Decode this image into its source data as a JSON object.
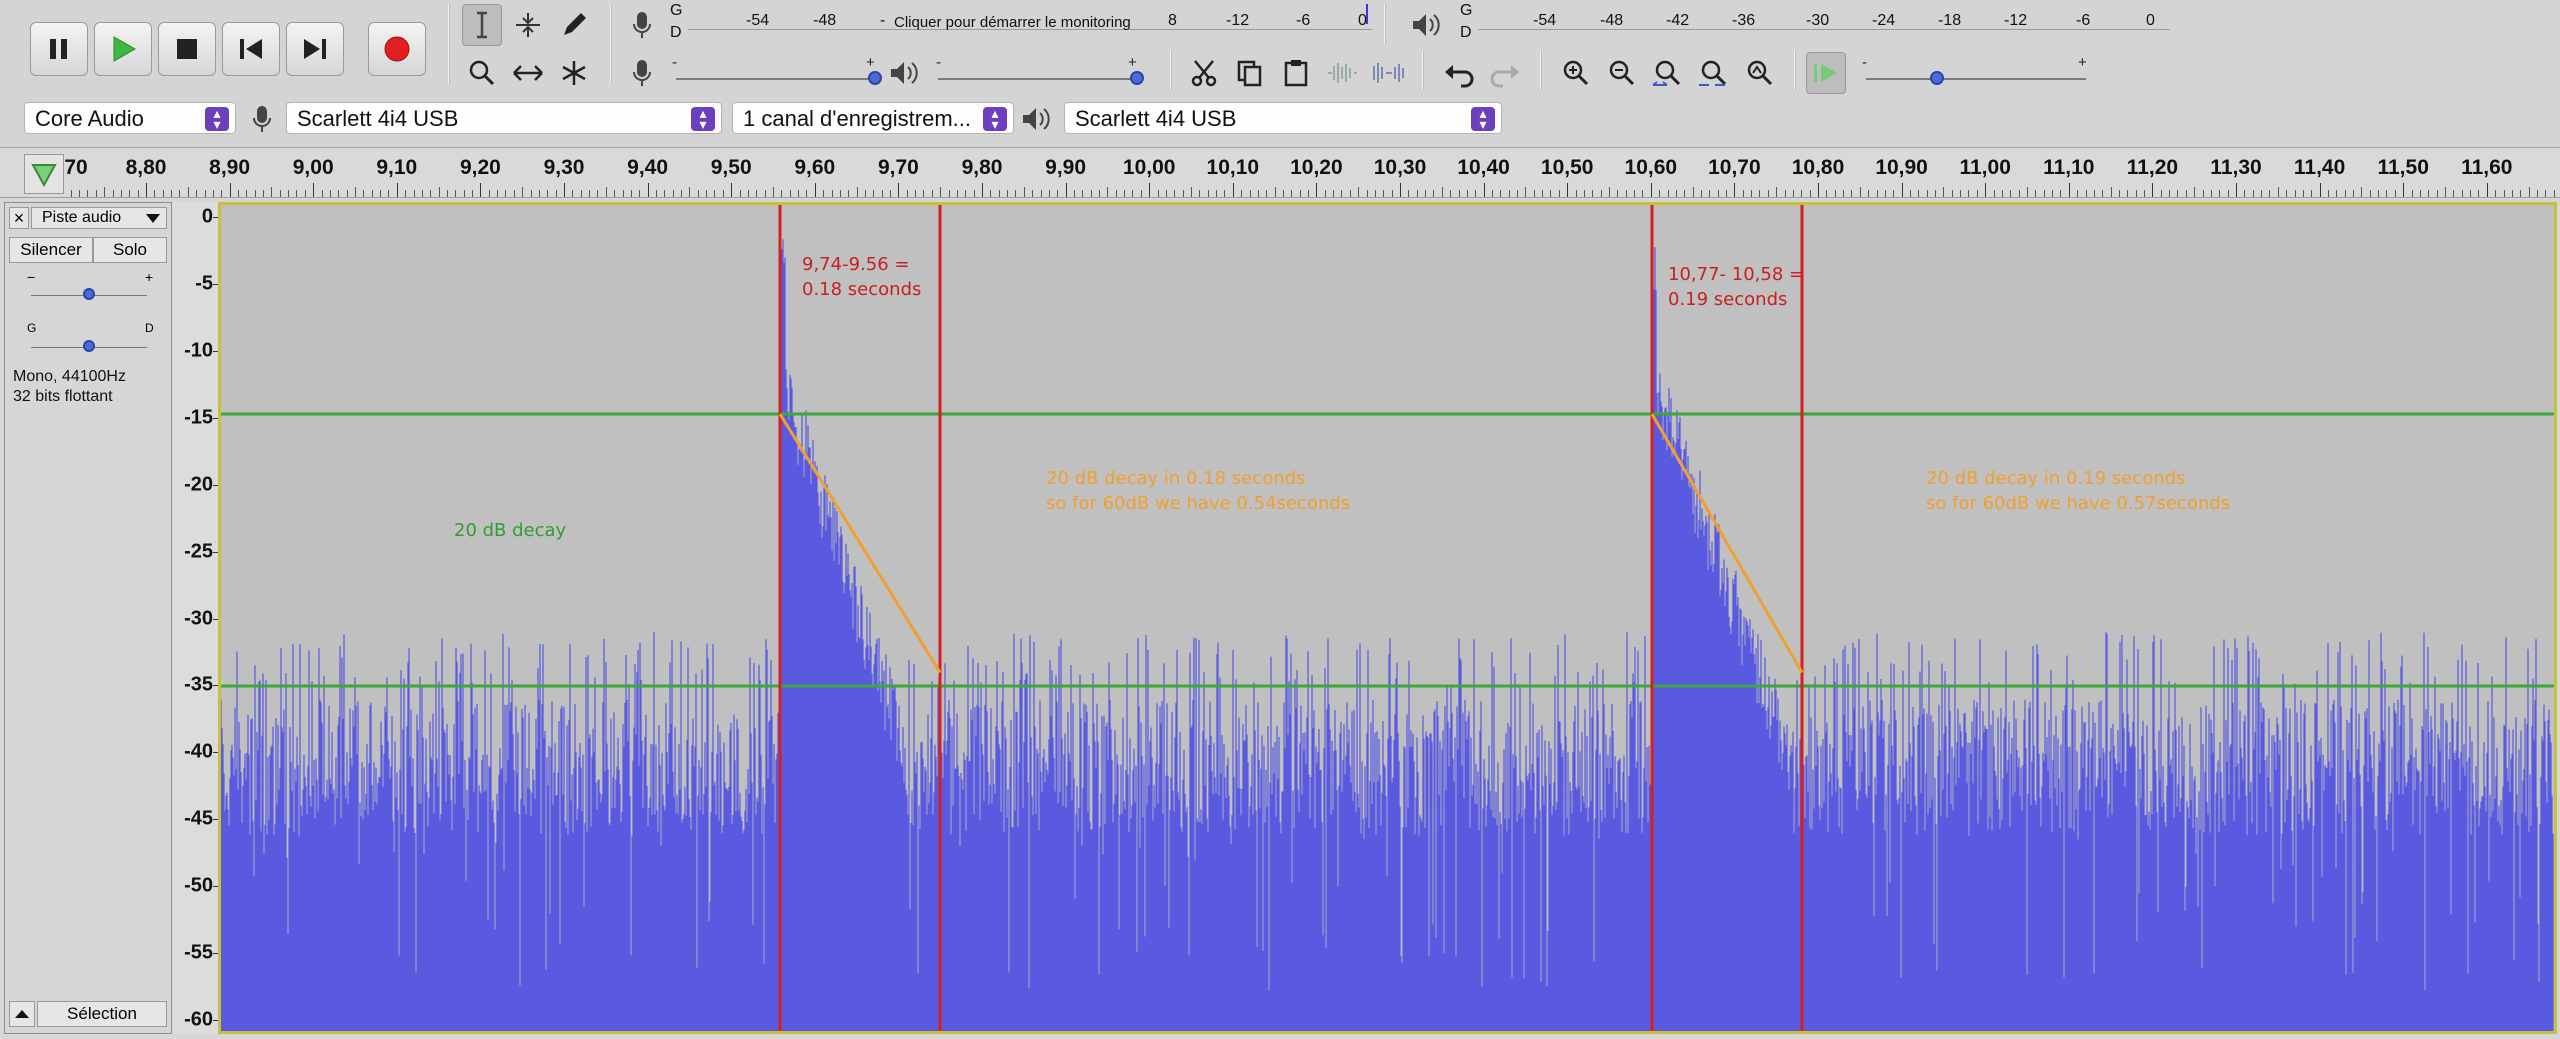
{
  "toolbar": {
    "transport": [
      {
        "name": "pause-button",
        "icon": "pause-icon"
      },
      {
        "name": "play-button",
        "icon": "play-icon"
      },
      {
        "name": "stop-button",
        "icon": "stop-icon"
      },
      {
        "name": "skip-start-button",
        "icon": "skip-to-start-icon"
      },
      {
        "name": "skip-end-button",
        "icon": "skip-to-end-icon"
      },
      {
        "name": "record-button",
        "icon": "record-icon"
      }
    ],
    "record_meter": {
      "channel_top": "G",
      "channel_bottom": "D",
      "ticks": [
        "-54",
        "-48",
        "-",
        "-12",
        "-6",
        "0"
      ],
      "monitor_prompt": "Cliquer pour démarrer le monitoring",
      "monitor_tick": "8"
    },
    "play_meter": {
      "channel_top": "G",
      "channel_bottom": "D",
      "ticks": [
        "-54",
        "-48",
        "-42",
        "-36",
        "-30",
        "-24",
        "-18",
        "-12",
        "-6",
        "0"
      ]
    },
    "rec_volume": {
      "minus": "-",
      "plus": "+"
    },
    "play_volume": {
      "minus": "-",
      "plus": "+"
    },
    "play_speed": {
      "minus": "-",
      "plus": "+"
    }
  },
  "devices": {
    "host": "Core Audio",
    "recording_device": "Scarlett 4i4 USB",
    "channels": "1 canal d'enregistrem...",
    "playback_device": "Scarlett 4i4 USB"
  },
  "timeline": {
    "first_label": "70",
    "labels": [
      "8,80",
      "8,90",
      "9,00",
      "9,10",
      "9,20",
      "9,30",
      "9,40",
      "9,50",
      "9,60",
      "9,70",
      "9,80",
      "9,90",
      "10,00",
      "10,10",
      "10,20",
      "10,30",
      "10,40",
      "10,50",
      "10,60",
      "10,70",
      "10,80",
      "10,90",
      "11,00",
      "11,10",
      "11,20",
      "11,30",
      "11,40",
      "11,50",
      "11,60"
    ]
  },
  "track": {
    "close": "×",
    "name": "Piste audio",
    "mute": "Silencer",
    "solo": "Solo",
    "gain_minus": "−",
    "gain_plus": "+",
    "pan_left": "G",
    "pan_right": "D",
    "info_line1": "Mono, 44100Hz",
    "info_line2": "32 bits flottant",
    "select": "Sélection",
    "db_labels": [
      "0",
      "-5",
      "-10",
      "-15",
      "-20",
      "-25",
      "-30",
      "-35",
      "-40",
      "-45",
      "-50",
      "-55",
      "-60"
    ]
  },
  "annotations": {
    "decay_label": "20 dB decay",
    "measure1": "9,74-9.56 =\n0.18 seconds",
    "measure2": "10,77- 10,58 =\n0.19 seconds",
    "result1": "20 dB decay in 0.18 seconds\nso for 60dB we have 0.54seconds",
    "result2": "20 dB decay in 0.19 seconds\nso for 60dB we have 0.57seconds"
  },
  "colors": {
    "waveform": "#5a5ae0",
    "waveform_edge": "#3a3ad0",
    "red_marker": "#d42020",
    "green_line": "#3aa83a",
    "orange": "#f0a030",
    "note_red": "#c82020",
    "note_green": "#2e9e2e"
  }
}
